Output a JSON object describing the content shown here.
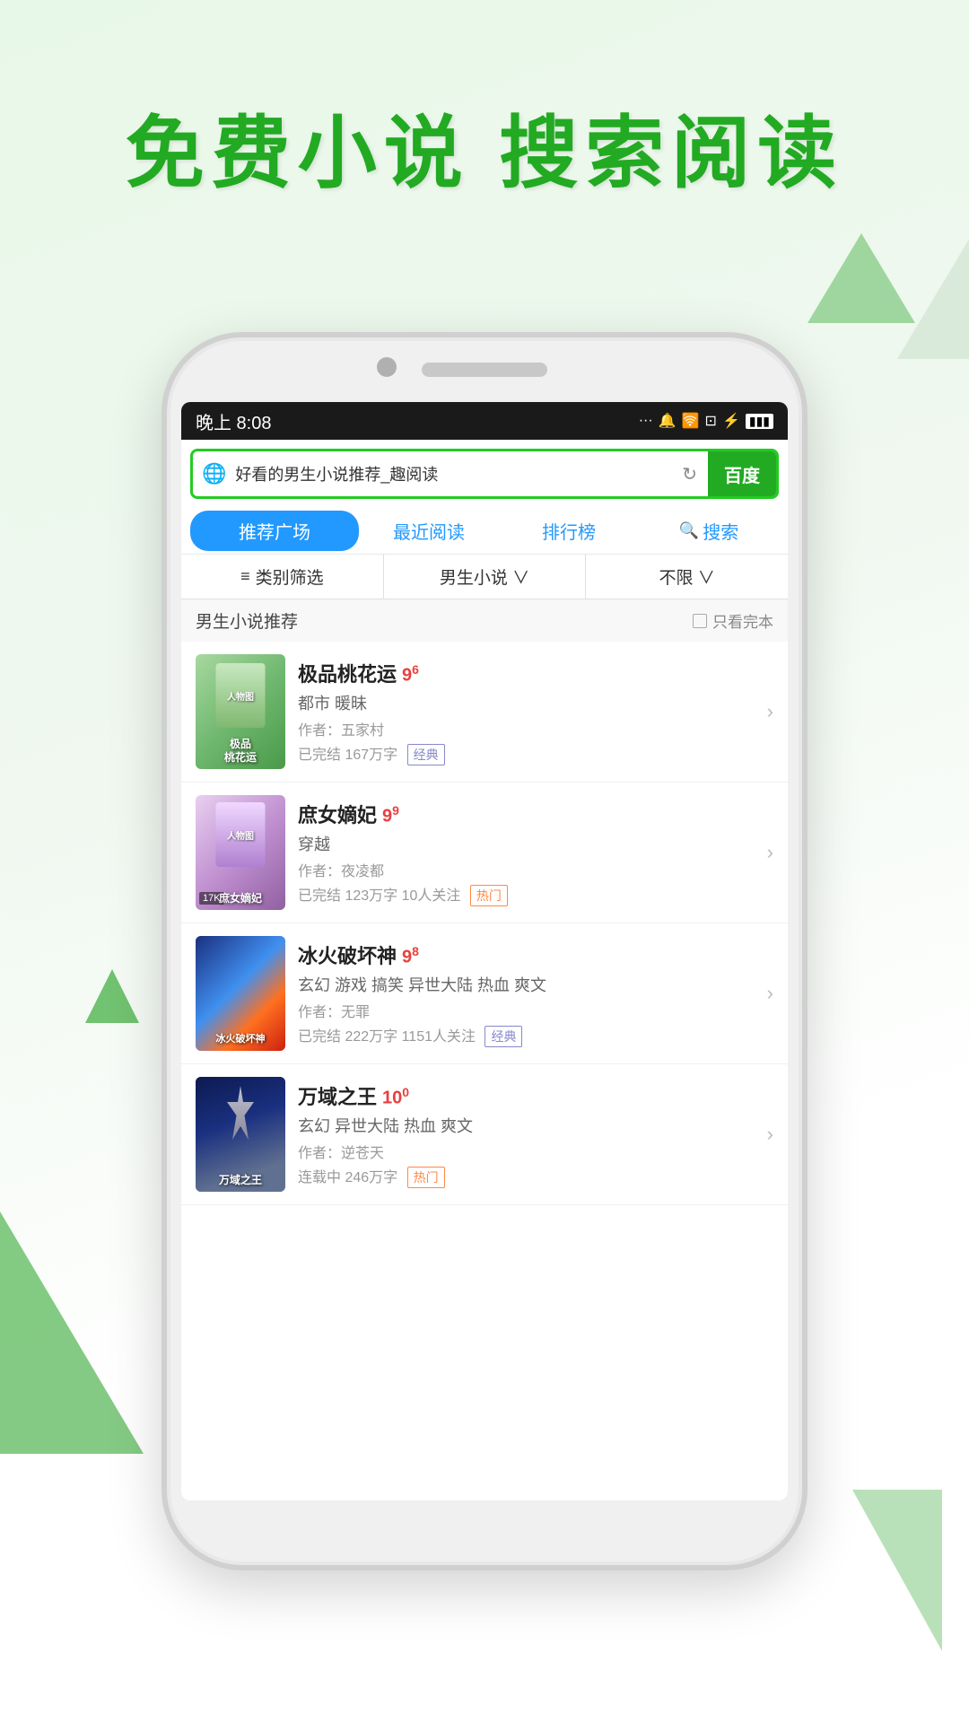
{
  "app": {
    "header_title": "免费小说  搜索阅读",
    "background_color": "#e8f8e8"
  },
  "status_bar": {
    "time": "晚上 8:08",
    "icons": "··· 🔔 🛜 📶 ⚡🔋"
  },
  "search": {
    "placeholder": "好看的男生小说推荐_趣阅读",
    "refresh_icon": "↻",
    "button_label": "百度",
    "globe_icon": "🌐"
  },
  "nav_tabs": [
    {
      "label": "推荐广场",
      "active": true
    },
    {
      "label": "最近阅读",
      "active": false
    },
    {
      "label": "排行榜",
      "active": false
    },
    {
      "label": "搜索",
      "active": false,
      "has_icon": true
    }
  ],
  "filter_bar": [
    {
      "label": "类别筛选",
      "icon": "≡"
    },
    {
      "label": "男生小说 ∨",
      "icon": ""
    },
    {
      "label": "不限 ∨",
      "icon": ""
    }
  ],
  "section": {
    "title": "男生小说推荐",
    "filter_label": "只看完本"
  },
  "books": [
    {
      "title": "极品桃花运",
      "rating": "9",
      "rating_decimal": "6",
      "genres": "都市 暖昧",
      "author": "作者：五家村",
      "meta": "已完结 167万字",
      "tag": "经典",
      "tag_type": "classic",
      "cover_bg": "cover1",
      "cover_label": "极品\n桃花运"
    },
    {
      "title": "庶女嫡妃",
      "rating": "9",
      "rating_decimal": "9",
      "genres": "穿越",
      "author": "作者：夜凌都",
      "meta": "已完结 123万字 10人关注",
      "tag": "热门",
      "tag_type": "hot",
      "cover_bg": "cover2",
      "cover_label": "庶女嫡妃",
      "badge": "17K"
    },
    {
      "title": "冰火破坏神",
      "rating": "9",
      "rating_decimal": "8",
      "genres": "玄幻 游戏 搞笑 异世大陆 热血 爽文",
      "author": "作者：无罪",
      "meta": "已完结 222万字 1151人关注",
      "tag": "经典",
      "tag_type": "classic",
      "cover_bg": "cover3",
      "cover_label": "冰火破坏神"
    },
    {
      "title": "万域之王",
      "rating": "10",
      "rating_decimal": "0",
      "genres": "玄幻 异世大陆 热血 爽文",
      "author": "作者：逆苍天",
      "meta": "连载中 246万字",
      "tag": "热门",
      "tag_type": "hot",
      "cover_bg": "cover4",
      "cover_label": "万域之王"
    }
  ]
}
